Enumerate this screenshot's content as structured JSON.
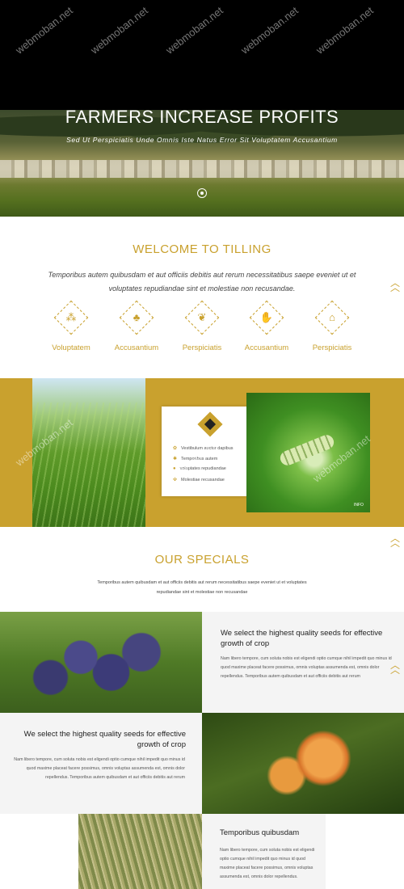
{
  "hero": {
    "title": "FARMERS INCREASE PROFITS",
    "subtitle": "Sed Ut Perspiciatis Unde Omnis Iste Natus Error Sit Voluptatem Accusantium"
  },
  "welcome": {
    "title": "WELCOME TO TILLING",
    "text": "Temporibus autem quibusdam et aut officiis debitis aut rerum necessitatibus saepe eveniet ut et voluptates repudiandae sint et molestiae non recusandae.",
    "features": [
      {
        "icon": "coffee-beans-icon",
        "label": "Voluptatem"
      },
      {
        "icon": "tree-icon",
        "label": "Accusantium"
      },
      {
        "icon": "wheat-icon",
        "label": "Perspiciatis"
      },
      {
        "icon": "hand-seed-icon",
        "label": "Accusantium"
      },
      {
        "icon": "farm-icon",
        "label": "Perspiciatis"
      }
    ]
  },
  "info_card": {
    "items": [
      "Vestibulum auctor dapibus",
      "Temporibus autem",
      "voluptates repudiandae",
      "Molestiae recusandae"
    ],
    "tag": "INFO"
  },
  "specials": {
    "title": "OUR SPECIALS",
    "text": "Temporibus autem quibusdam et aut officiis debitis aut rerum necessitatibus saepe eveniet ut et voluptates repudiandae sint et molestiae non recusandae"
  },
  "rows": [
    {
      "title": "We select the highest quality seeds for effective growth of crop",
      "body": "Nam libero tempore, cum soluta nobis est eligendi optio cumque nihil impedit quo minus id quod maxime placeat facere possimus, omnis voluptas assumenda est, omnis dolor repellendus. Temporibus autem quibusdam et aut officiis debitis aut rerum"
    },
    {
      "title": "We select the highest quality seeds for effective growth of crop",
      "body": "Nam libero tempore, cum soluta nobis est eligendi optio cumque nihil impedit quo minus id quod maxime placeat facere possimus, omnis voluptas assumenda est, omnis dolor repellendus. Temporibus autem quibusdam et aut officiis debitis aut rerum"
    },
    {
      "title": "Temporibus quibusdam",
      "body": "Nam libero tempore, cum soluta nobis est eligendi optio cumque nihil impedit quo minus id quod maxime placeat facere possimus, omnis voluptas assumenda est, omnis dolor repellendus."
    }
  ],
  "watermark": "webmoban.net",
  "colors": {
    "accent": "#c9a12e",
    "dark": "#000000",
    "panel": "#f4f4f4"
  }
}
